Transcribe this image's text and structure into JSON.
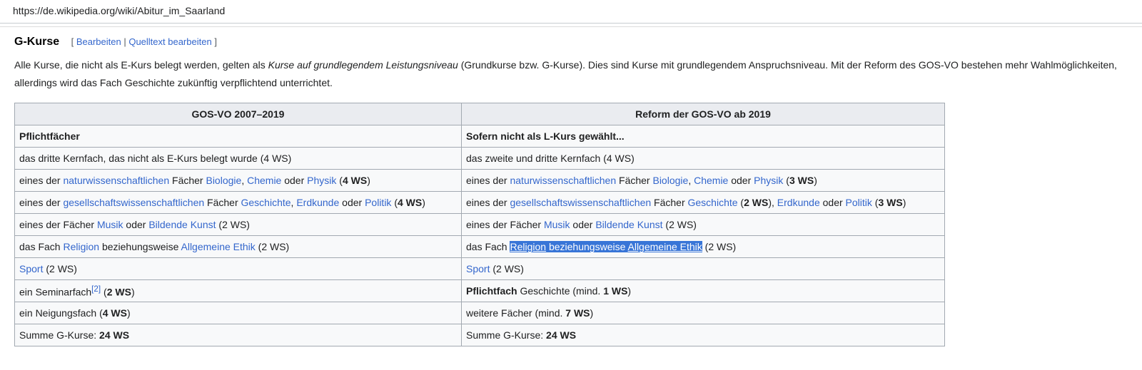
{
  "browser": {
    "url": "https://de.wikipedia.org/wiki/Abitur_im_Saarland"
  },
  "section": {
    "title": "G-Kurse",
    "edit_open": "[",
    "edit_link": "Bearbeiten",
    "edit_pipe": " | ",
    "source_link": "Quelltext bearbeiten",
    "edit_close": "]"
  },
  "intro": {
    "t1": "Alle Kurse, die nicht als E-Kurs belegt werden, gelten als ",
    "t2": "Kurse auf grundlegendem Leistungsniveau",
    "t3": " (Grundkurse bzw. G-Kurse). Dies sind Kurse mit grundlegendem Anspruchsniveau. Mit der Reform des GOS-VO bestehen mehr Wahlmöglichkeiten, allerdings wird das Fach Geschichte zukünftig verpflichtend unterrichtet."
  },
  "table": {
    "headers": [
      "GOS-VO 2007–2019",
      "Reform der GOS-VO ab 2019"
    ],
    "r1": {
      "left": "Pflichtfächer",
      "right": "Sofern nicht als L-Kurs gewählt..."
    },
    "r2": {
      "left": "das dritte Kernfach, das nicht als E-Kurs belegt wurde (4 WS)",
      "right": "das zweite und dritte Kernfach (4 WS)"
    },
    "r3": {
      "l1": "eines der ",
      "l_nat": "naturwissenschaftlichen",
      "l2": " Fächer ",
      "l_bio": "Biologie",
      "l_c1": ", ",
      "l_chem": "Chemie",
      "l_oder": " oder ",
      "l_phys": "Physik",
      "l_open": " (",
      "l_ws": "4 WS",
      "l_close": ")",
      "r1": "eines der ",
      "r_nat": "naturwissenschaftlichen",
      "r2": " Fächer ",
      "r_bio": "Biologie",
      "r_c1": ", ",
      "r_chem": "Chemie",
      "r_oder": " oder ",
      "r_phys": "Physik",
      "r_open": " (",
      "r_ws": "3 WS",
      "r_close": ")"
    },
    "r4": {
      "l1": "eines der ",
      "l_ges": "gesellschaftswissenschaftlichen",
      "l2": " Fächer ",
      "l_gesch": "Geschichte",
      "l_c1": ", ",
      "l_erd": "Erdkunde",
      "l_oder": " oder ",
      "l_pol": "Politik",
      "l_open": " (",
      "l_ws": "4 WS",
      "l_close": ")",
      "r1": "eines der ",
      "r_ges": "gesellschaftswissenschaftlichen",
      "r2": " Fächer ",
      "r_gesch": "Geschichte",
      "r_open1": " (",
      "r_ws1": "2 WS",
      "r_close1": "), ",
      "r_erd": "Erdkunde",
      "r_oder": " oder ",
      "r_pol": "Politik",
      "r_open2": " (",
      "r_ws2": "3 WS",
      "r_close2": ")"
    },
    "r5": {
      "l1": "eines der Fächer ",
      "l_mus": "Musik",
      "l_oder": " oder ",
      "l_kunst": "Bildende Kunst",
      "l_ws": " (2 WS)",
      "r1": "eines der Fächer ",
      "r_mus": "Musik",
      "r_oder": " oder ",
      "r_kunst": "Bildende Kunst",
      "r_ws": " (2 WS)"
    },
    "r6": {
      "l1": "das Fach ",
      "l_rel": "Religion",
      "l_bzw": " beziehungsweise ",
      "l_ethik": "Allgemeine Ethik",
      "l_ws": " (2 WS)",
      "r1": "das Fach ",
      "r_rel": "Religion",
      "r_bzw": " beziehungsweise ",
      "r_ethik": "Allgemeine Ethik",
      "r_ws": " (2 WS)"
    },
    "r7": {
      "l_sport": "Sport",
      "l_ws": " (2 WS)",
      "r_sport": "Sport",
      "r_ws": " (2 WS)"
    },
    "r8": {
      "l1": "ein Seminarfach",
      "l_ref": "[2]",
      "l_open": " (",
      "l_ws": "2 WS",
      "l_close": ")",
      "r_bold": "Pflichtfach",
      "r1": " Geschichte (mind. ",
      "r_ws": "1 WS",
      "r_close": ")"
    },
    "r9": {
      "l1": "ein Neigungsfach (",
      "l_ws": "4 WS",
      "l_close": ")",
      "r1": "weitere Fächer (mind. ",
      "r_ws": "7 WS",
      "r_close": ")"
    },
    "r10": {
      "l1": "Summe G-Kurse: ",
      "l_ws": "24 WS",
      "r1": "Summe G-Kurse: ",
      "r_ws": "24 WS"
    }
  },
  "colors": {
    "link": "#3366cc",
    "selection": "#3875d7",
    "table_border": "#a2a9b1",
    "header_bg": "#eaecf0"
  }
}
